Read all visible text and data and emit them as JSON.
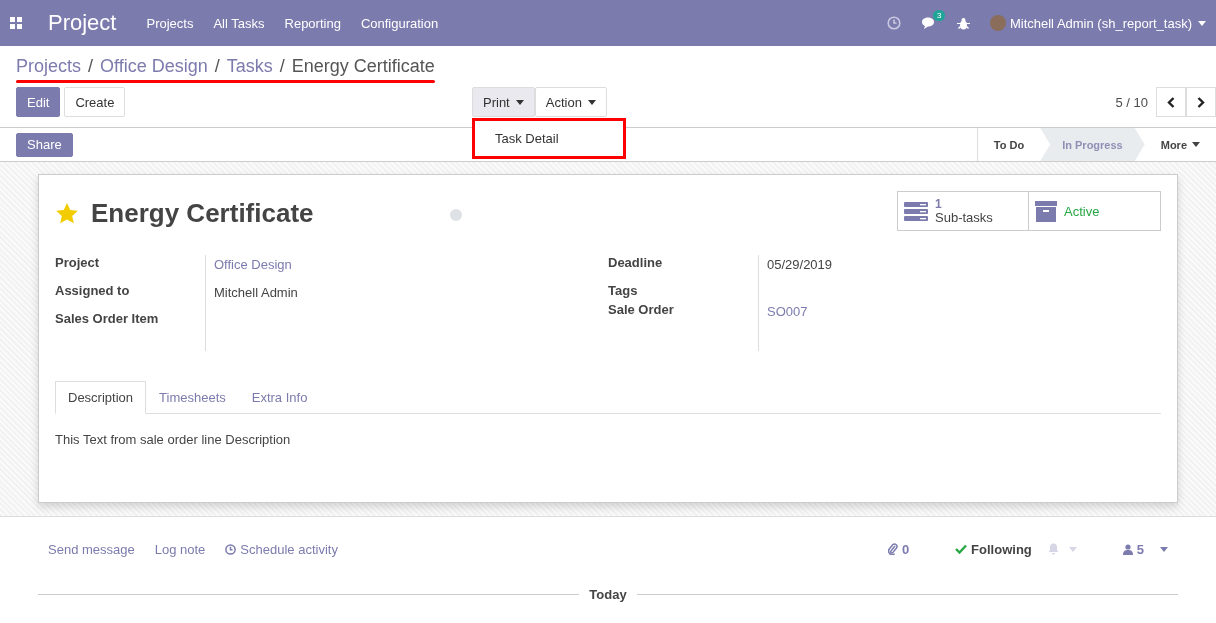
{
  "navbar": {
    "app_title": "Project",
    "menu": [
      "Projects",
      "All Tasks",
      "Reporting",
      "Configuration"
    ],
    "chat_count": "3",
    "user": "Mitchell Admin (sh_report_task)"
  },
  "breadcrumb_separator": "/",
  "breadcrumb": [
    {
      "label": "Projects",
      "link": true
    },
    {
      "label": "Office Design",
      "link": true
    },
    {
      "label": "Tasks",
      "link": true
    },
    {
      "label": "Energy Certificate",
      "link": false
    }
  ],
  "buttons": {
    "primary": "Edit",
    "secondary": "Create",
    "share": "Share"
  },
  "dropdowns": [
    {
      "label": "Print",
      "open": true
    },
    {
      "label": "Action",
      "open": false
    }
  ],
  "print_menu": {
    "items": [
      {
        "label": "Task Detail",
        "highlighted": true
      }
    ]
  },
  "pager": "5 / 10",
  "stages": [
    {
      "label": "To Do",
      "selected": false
    },
    {
      "label": "In Progress",
      "selected": true
    }
  ],
  "stages_more": "More",
  "task": {
    "starred": true,
    "title": "Energy Certificate"
  },
  "smart_buttons": [
    {
      "kind": "count",
      "value": "1",
      "label": "Sub-tasks"
    },
    {
      "kind": "toggle",
      "label": "Active",
      "on": true
    }
  ],
  "fields_left": [
    {
      "label": "Project",
      "value": "Office Design",
      "kind": "link"
    },
    {
      "label": "Assigned to",
      "value": "Mitchell Admin",
      "kind": "text"
    },
    {
      "label": "Sales Order Item"
    }
  ],
  "fields_right": [
    {
      "label": "Deadline",
      "value": "05/29/2019",
      "kind": "text"
    },
    {
      "label": "Tags"
    },
    {
      "label": "Sale Order",
      "value": "SO007",
      "kind": "link"
    }
  ],
  "tabs": [
    {
      "label": "Description",
      "selected": true
    },
    {
      "label": "Timesheets",
      "selected": false
    },
    {
      "label": "Extra Info",
      "selected": false
    }
  ],
  "description": "This Text from sale order line Description",
  "chatter": {
    "actions": [
      "Send message",
      "Log note",
      "Schedule activity"
    ],
    "attachments": "0",
    "following": "Following",
    "followers": "5",
    "divider": "Today"
  }
}
